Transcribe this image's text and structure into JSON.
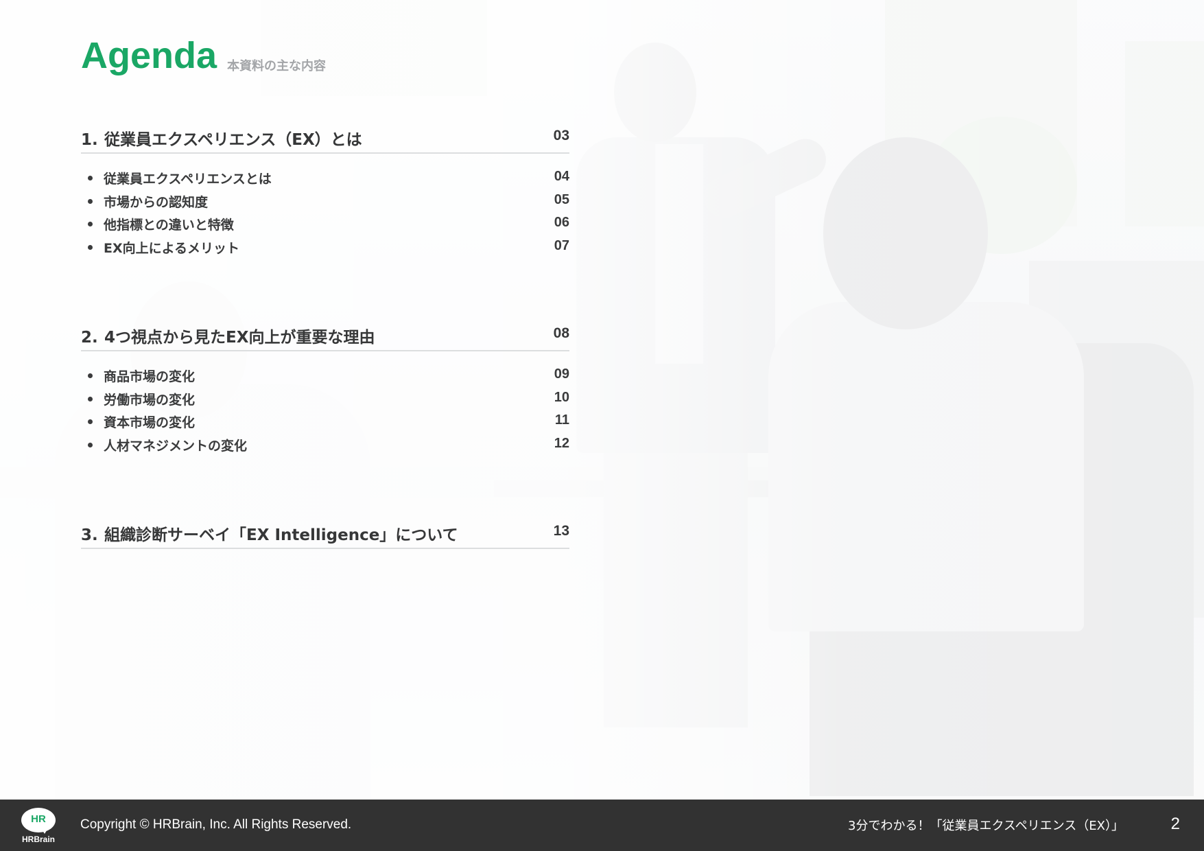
{
  "header": {
    "title": "Agenda",
    "subtitle": "本資料の主な内容"
  },
  "sections": [
    {
      "number": "1.",
      "title": "従業員エクスペリエンス（EX）とは",
      "page": "03",
      "items": [
        {
          "label": "従業員エクスペリエンスとは",
          "page": "04"
        },
        {
          "label": "市場からの認知度",
          "page": "05"
        },
        {
          "label": "他指標との違いと特徴",
          "page": "06"
        },
        {
          "label": "EX向上によるメリット",
          "page": "07"
        }
      ]
    },
    {
      "number": "2.",
      "title": "4つ視点から見たEX向上が重要な理由",
      "page": "08",
      "items": [
        {
          "label": "商品市場の変化",
          "page": "09"
        },
        {
          "label": "労働市場の変化",
          "page": "10"
        },
        {
          "label": "資本市場の変化",
          "page": "11"
        },
        {
          "label": "人材マネジメントの変化",
          "page": "12"
        }
      ]
    },
    {
      "number": "3.",
      "title": "組織診断サーベイ「EX Intelligence」について",
      "page": "13",
      "items": []
    }
  ],
  "footer": {
    "logo_mark": "HR",
    "logo_word": "HRBrain",
    "copyright": "Copyright © HRBrain, Inc. All Rights Reserved.",
    "doc_title": "3分でわかる！「従業員エクスペリエンス（EX）」",
    "page_number": "2"
  },
  "colors": {
    "accent": "#1aa765",
    "text": "#363738",
    "footer_bg": "#323232"
  }
}
